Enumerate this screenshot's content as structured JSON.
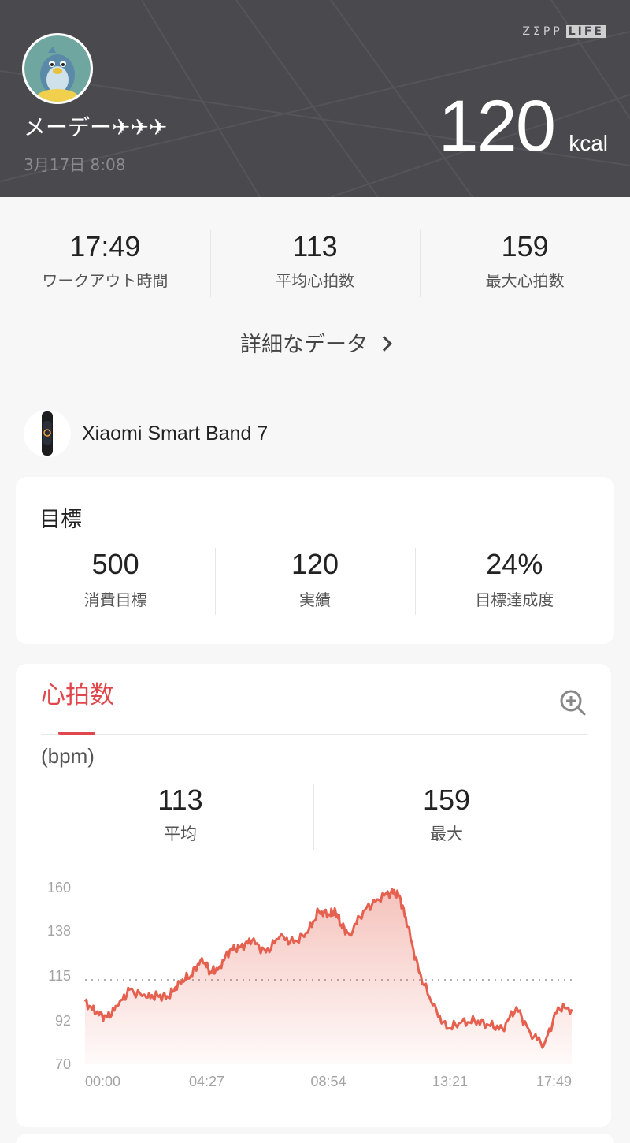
{
  "header": {
    "brand_main": "ZΣPP",
    "brand_box": "LIFE",
    "user_name": "メーデー✈✈✈",
    "date": "3月17日 8:08",
    "calories_value": "120",
    "calories_unit": "kcal"
  },
  "summary": [
    {
      "value": "17:49",
      "label": "ワークアウト時間"
    },
    {
      "value": "113",
      "label": "平均心拍数"
    },
    {
      "value": "159",
      "label": "最大心拍数"
    }
  ],
  "details_link": "詳細なデータ",
  "device": {
    "name": "Xiaomi Smart Band 7"
  },
  "goal": {
    "title": "目標",
    "items": [
      {
        "value": "500",
        "label": "消費目標"
      },
      {
        "value": "120",
        "label": "実績"
      },
      {
        "value": "24%",
        "label": "目標達成度"
      }
    ]
  },
  "heart_rate": {
    "tab_label": "心拍数",
    "unit": "(bpm)",
    "stats": [
      {
        "value": "113",
        "label": "平均"
      },
      {
        "value": "159",
        "label": "最大"
      }
    ]
  },
  "colors": {
    "accent": "#e0474c",
    "header_bg": "#4a4a4e",
    "line": "#e5604f"
  },
  "chart_data": {
    "type": "area",
    "ylabel": "",
    "yticks": [
      160,
      138,
      115,
      92,
      70
    ],
    "xticks": [
      "00:00",
      "04:27",
      "08:54",
      "13:21",
      "17:49"
    ],
    "ylim": [
      70,
      160
    ],
    "average_line": 113,
    "x_minutes": [
      0,
      0.4,
      0.8,
      1.2,
      1.6,
      2.2,
      2.6,
      3.0,
      3.4,
      3.8,
      4.2,
      4.5,
      4.8,
      5.2,
      5.6,
      6.0,
      6.5,
      7.0,
      7.5,
      8.0,
      8.4,
      8.8,
      9.0,
      9.2,
      9.5,
      10.0,
      10.5,
      11.0,
      11.3,
      11.6,
      12.0,
      12.5,
      13.0,
      13.5,
      14.0,
      14.5,
      15.0,
      15.5,
      16.0,
      16.5,
      17.0,
      17.49
    ],
    "y_bpm": [
      102,
      96,
      94,
      100,
      108,
      104,
      105,
      104,
      112,
      115,
      124,
      117,
      119,
      128,
      130,
      133,
      127,
      135,
      132,
      137,
      148,
      146,
      148,
      141,
      136,
      148,
      154,
      158,
      156,
      140,
      117,
      100,
      88,
      91,
      92,
      90,
      88,
      99,
      86,
      80,
      99,
      98
    ]
  }
}
